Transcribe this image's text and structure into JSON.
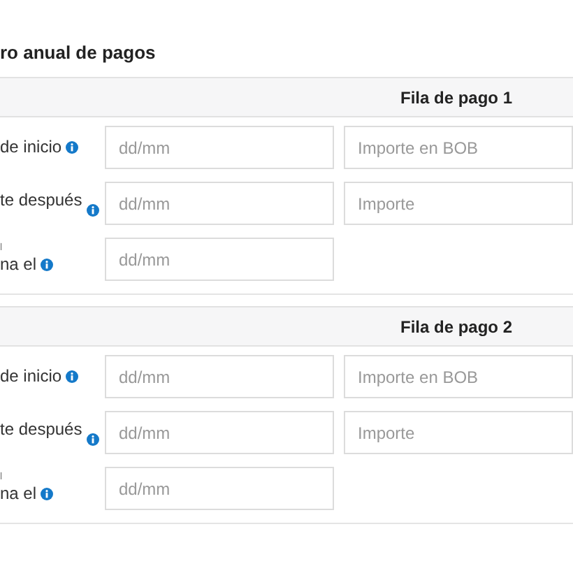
{
  "title": "ro anual de pagos",
  "sections": [
    {
      "header": "Fila de pago 1",
      "rows": [
        {
          "label": "de inicio",
          "fields": [
            {
              "placeholder": "dd/mm"
            },
            {
              "placeholder": "Importe en BOB"
            }
          ]
        },
        {
          "label": "te después",
          "fields": [
            {
              "placeholder": "dd/mm"
            },
            {
              "placeholder": "Importe"
            }
          ]
        },
        {
          "note": "l",
          "label": "na el",
          "fields": [
            {
              "placeholder": "dd/mm"
            }
          ]
        }
      ]
    },
    {
      "header": "Fila de pago 2",
      "rows": [
        {
          "label": "de inicio",
          "fields": [
            {
              "placeholder": "dd/mm"
            },
            {
              "placeholder": "Importe en BOB"
            }
          ]
        },
        {
          "label": "te después",
          "fields": [
            {
              "placeholder": "dd/mm"
            },
            {
              "placeholder": "Importe"
            }
          ]
        },
        {
          "note": "l",
          "label": "na el",
          "fields": [
            {
              "placeholder": "dd/mm"
            }
          ]
        }
      ]
    }
  ]
}
